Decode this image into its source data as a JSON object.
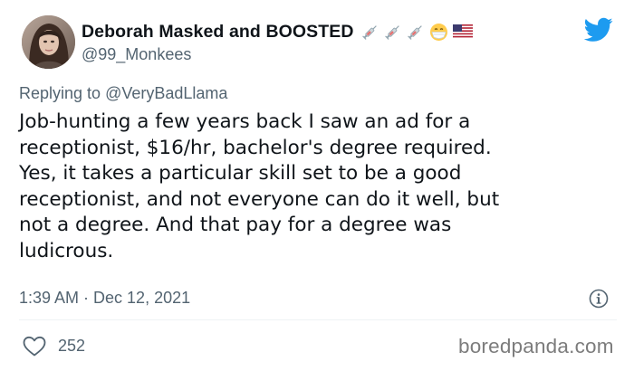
{
  "author": {
    "display_name": "Deborah Masked and BOOSTED",
    "name_emojis": [
      "syringe-icon",
      "syringe-icon",
      "syringe-icon",
      "mask-face-icon",
      "us-flag-icon"
    ],
    "handle": "@99_Monkees"
  },
  "reply": {
    "prefix": "Replying to",
    "handle": "@VeryBadLlama"
  },
  "tweet": {
    "text": "Job-hunting a few years back I saw an ad for a\nreceptionist, $16/hr, bachelor's degree required.\nYes, it takes a particular skill set to be a good\nreceptionist, and not everyone can do it well, but\nnot a degree. And that pay for a degree was\nludicrous.",
    "timestamp": "1:39 AM · Dec 12, 2021"
  },
  "stats": {
    "likes": "252"
  },
  "watermark": "boredpanda.com",
  "colors": {
    "twitter_blue": "#1d9bf0",
    "secondary_text": "#536471",
    "primary_text": "#0f1419",
    "divider": "#eff3f4",
    "watermark": "#7c7c7c"
  },
  "icons": {
    "brand": "twitter-bird-icon",
    "info": "info-icon",
    "like": "heart-icon"
  }
}
